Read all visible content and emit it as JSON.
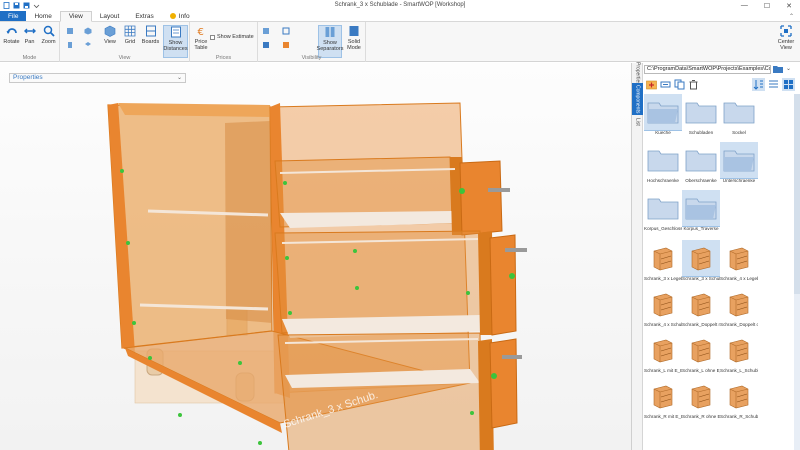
{
  "window": {
    "title": "Schrank_3 x Schublade - SmartWOP [Workshop]",
    "controls": [
      "—",
      "☐",
      "✕"
    ]
  },
  "tabs": [
    {
      "label": "File"
    },
    {
      "label": "Home"
    },
    {
      "label": "View"
    },
    {
      "label": "Layout"
    },
    {
      "label": "Extras"
    },
    {
      "label": "Info"
    }
  ],
  "ribbon": {
    "mode": {
      "label": "Mode",
      "buttons": [
        "Rotate",
        "Pan",
        "Zoom"
      ]
    },
    "view": {
      "label": "View",
      "buttons": [
        "View",
        "Grid",
        "Boards",
        "Show\nDistances",
        "Price\nTable"
      ],
      "show_estimate": "Show Estimate"
    },
    "prices": {
      "label": "Prices"
    },
    "visibility": {
      "label": "Visibility",
      "buttons": [
        "Show\nSeparators",
        "Solid\nMode"
      ]
    },
    "center_view": "Center\nView",
    "colors": {
      "accent": "#1f6fc5",
      "selected": "#cfe0f2",
      "wood": "#e9852f"
    }
  },
  "properties": {
    "label": "Properties"
  },
  "scene": {
    "watermark": "Schrank_3 x Schub."
  },
  "right_panel": {
    "vertical_tabs": [
      "Properties",
      "Components",
      "List"
    ],
    "path": "C:\\ProgramData\\SmartWOP\\Projects\\Examples\\Com",
    "folders": [
      {
        "name": "Kueche",
        "selected": true
      },
      {
        "name": "Schubladen",
        "selected": false
      },
      {
        "name": "Sockel",
        "selected": false
      },
      {
        "name": "Hochschraenke",
        "selected": false
      },
      {
        "name": "Oberschraenke",
        "selected": false
      },
      {
        "name": "Unterschraenke",
        "selected": true
      },
      {
        "name": "Korpus_Geschlossen",
        "selected": false
      },
      {
        "name": "Korpus_Traverse",
        "selected": true
      }
    ],
    "items": [
      {
        "name": "Schrank_3 x Legebo...",
        "selected": false
      },
      {
        "name": "Schrank_3 x Schubla...",
        "selected": true
      },
      {
        "name": "Schrank_4 x Legebo...",
        "selected": false
      },
      {
        "name": "Schrank_4 x Schubla...",
        "selected": false
      },
      {
        "name": "Schrank_Doppelt mit...",
        "selected": false
      },
      {
        "name": "Schrank_Doppelt o...",
        "selected": false
      },
      {
        "name": "Schrank_L mit E_Bo...",
        "selected": false
      },
      {
        "name": "Schrank_L ohne E_...",
        "selected": false
      },
      {
        "name": "Schrank_L_Schubla...",
        "selected": false
      },
      {
        "name": "Schrank_R mit E_Bo...",
        "selected": false
      },
      {
        "name": "Schrank_R ohne E_...",
        "selected": false
      },
      {
        "name": "Schrank_R_Schubla...",
        "selected": false
      }
    ]
  }
}
